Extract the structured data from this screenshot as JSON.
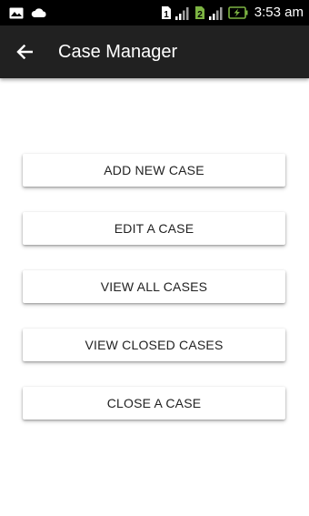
{
  "status_bar": {
    "time": "3:53 am",
    "sim1": "1",
    "sim2": "2",
    "icons": [
      "image-icon",
      "cloud-icon",
      "sim1-signal-icon",
      "sim2-signal-icon",
      "battery-charging-icon"
    ],
    "sim2_color": "#7cb342",
    "battery_color": "#7cb342"
  },
  "app_bar": {
    "title": "Case Manager",
    "back_icon": "arrow-left-icon",
    "background": "#212121"
  },
  "menu": {
    "items": [
      {
        "label": "ADD NEW CASE"
      },
      {
        "label": "EDIT A CASE"
      },
      {
        "label": "VIEW ALL CASES"
      },
      {
        "label": "VIEW CLOSED CASES"
      },
      {
        "label": "CLOSE A CASE"
      }
    ]
  }
}
